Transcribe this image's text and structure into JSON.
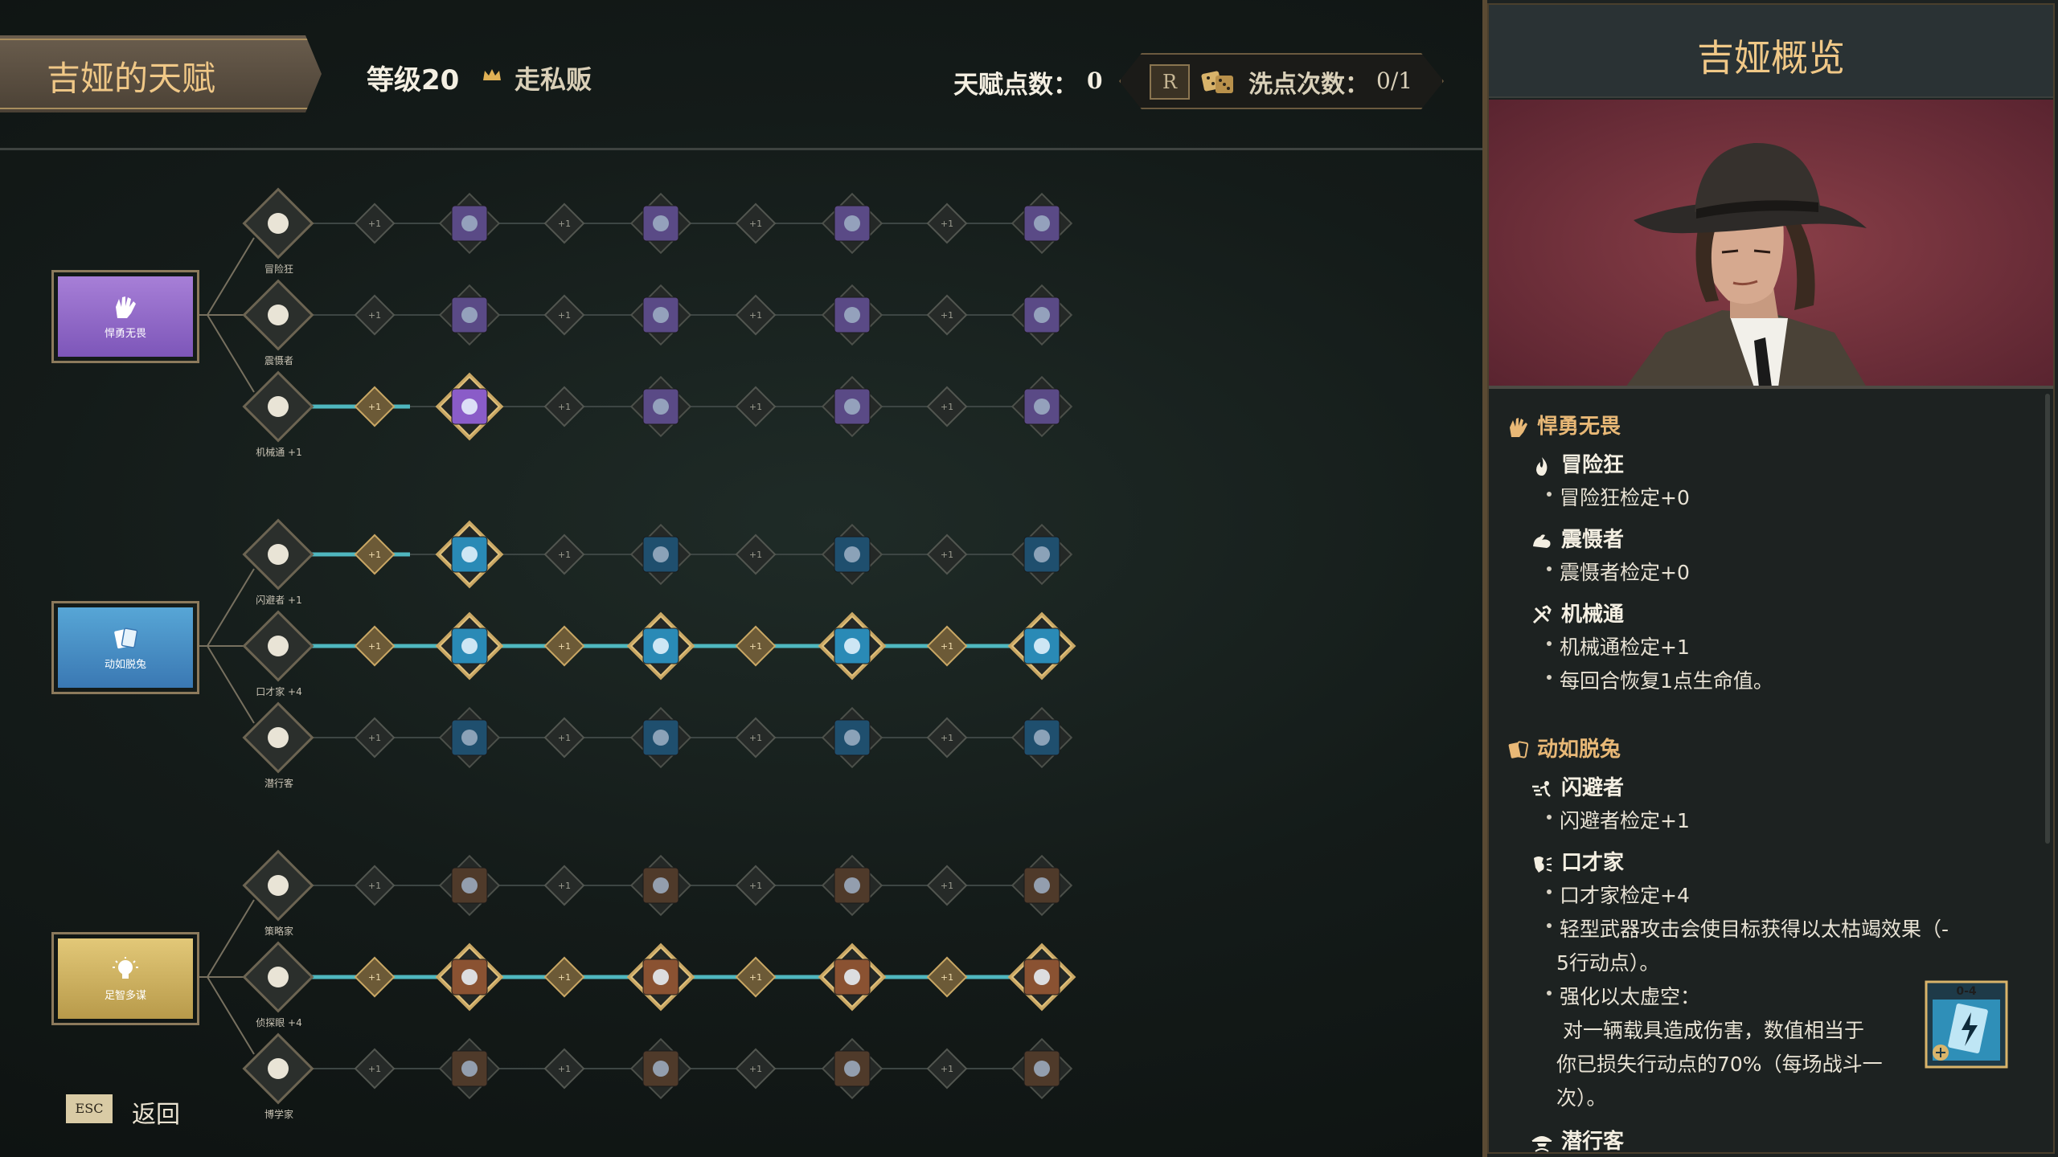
{
  "header": {
    "title": "吉娅的天赋",
    "level": "等级20",
    "class_name": "走私贩",
    "talent_points_label": "天赋点数：",
    "talent_points_value": "0",
    "reset_key": "R",
    "reset_label": "洗点次数：",
    "reset_value": "0/1"
  },
  "footer": {
    "esc_key": "ESC",
    "back_label": "返回"
  },
  "tree": {
    "node_plus_label": "+1",
    "branches": [
      {
        "name": "悍勇无畏",
        "color": "#8f66c8",
        "icon": "hand-icon",
        "skills": [
          {
            "label": "冒险狂",
            "icon": "flame-icon",
            "active_links": 0,
            "nodes": [
              "lightning-card-icon",
              "x-card-icon",
              "heart-lightning-icon",
              "x-card-icon"
            ]
          },
          {
            "label": "震慑者",
            "icon": "flex-arm-icon",
            "active_links": 0,
            "nodes": [
              "shield-slash-icon",
              "bug-icon",
              "shield-slash-icon",
              "bug-icon"
            ]
          },
          {
            "label": "机械通 +1",
            "icon": "tools-icon",
            "active_links": 1,
            "nodes": [
              "heart-plus-icon",
              "gear-burst-icon",
              "heart-bolt-icon",
              "gear-burst-icon"
            ]
          }
        ]
      },
      {
        "name": "动如脱兔",
        "color": "#3d8cc4",
        "icon": "cards-icon",
        "skills": [
          {
            "label": "闪避者 +1",
            "icon": "dash-icon",
            "active_links": 1,
            "nodes": [
              "armor-icon",
              "swirl-icon",
              "shield-tag-icon",
              "swirl-icon"
            ]
          },
          {
            "label": "口才家 +4",
            "icon": "speech-icon",
            "active_links": 4,
            "nodes": [
              "card-plus-icon",
              "bolt-card-icon",
              "cards-plus-icon",
              "bolt-card-icon"
            ]
          },
          {
            "label": "潜行客",
            "icon": "spy-icon",
            "active_links": 0,
            "nodes": [
              "bullet-icon",
              "wave-icon",
              "bullets-plus-icon",
              "wave-icon"
            ]
          }
        ]
      },
      {
        "name": "足智多谋",
        "color": "#d7b960",
        "icon": "bulb-icon",
        "skills": [
          {
            "label": "策略家",
            "icon": "chess-icon",
            "active_links": 0,
            "nodes": [
              "castle-icon",
              "orb-icon",
              "castle-icon",
              "orb-icon"
            ]
          },
          {
            "label": "侦探眼 +4",
            "icon": "magnifier-icon",
            "active_links": 4,
            "nodes": [
              "burst-icon",
              "ring-icon",
              "burst-icon",
              "ring-icon"
            ]
          },
          {
            "label": "博学家",
            "icon": "brain-icon",
            "active_links": 0,
            "nodes": [
              "burst-icon",
              "cross-icon",
              "burst-icon",
              "cross-icon"
            ]
          }
        ]
      }
    ]
  },
  "panel": {
    "title": "吉娅概览",
    "sections": {
      "brave": {
        "name": "悍勇无畏",
        "s1_name": "冒险狂",
        "s1_l1": "冒险狂检定+0",
        "s2_name": "震慑者",
        "s2_l1": "震慑者检定+0",
        "s3_name": "机械通",
        "s3_l1": "机械通检定+1",
        "s3_l2": "每回合恢复1点生命值。"
      },
      "swift": {
        "name": "动如脱兔",
        "s1_name": "闪避者",
        "s1_l1": "闪避者检定+1",
        "s2_name": "口才家",
        "s2_l1": "口才家检定+4",
        "s2_l2a": "轻型武器攻击会使目标获得以太枯竭效果（-",
        "s2_l2b": "5行动点）。",
        "s2_l3": "强化以太虚空：",
        "s2_l3a": "对一辆载具造成伤害，数值相当于",
        "s2_l3b": "你已损失行动点的70%（每场战斗一",
        "s2_l3c": "次）。",
        "s3_name": "潜行客"
      }
    },
    "card_cost": "0-4"
  }
}
